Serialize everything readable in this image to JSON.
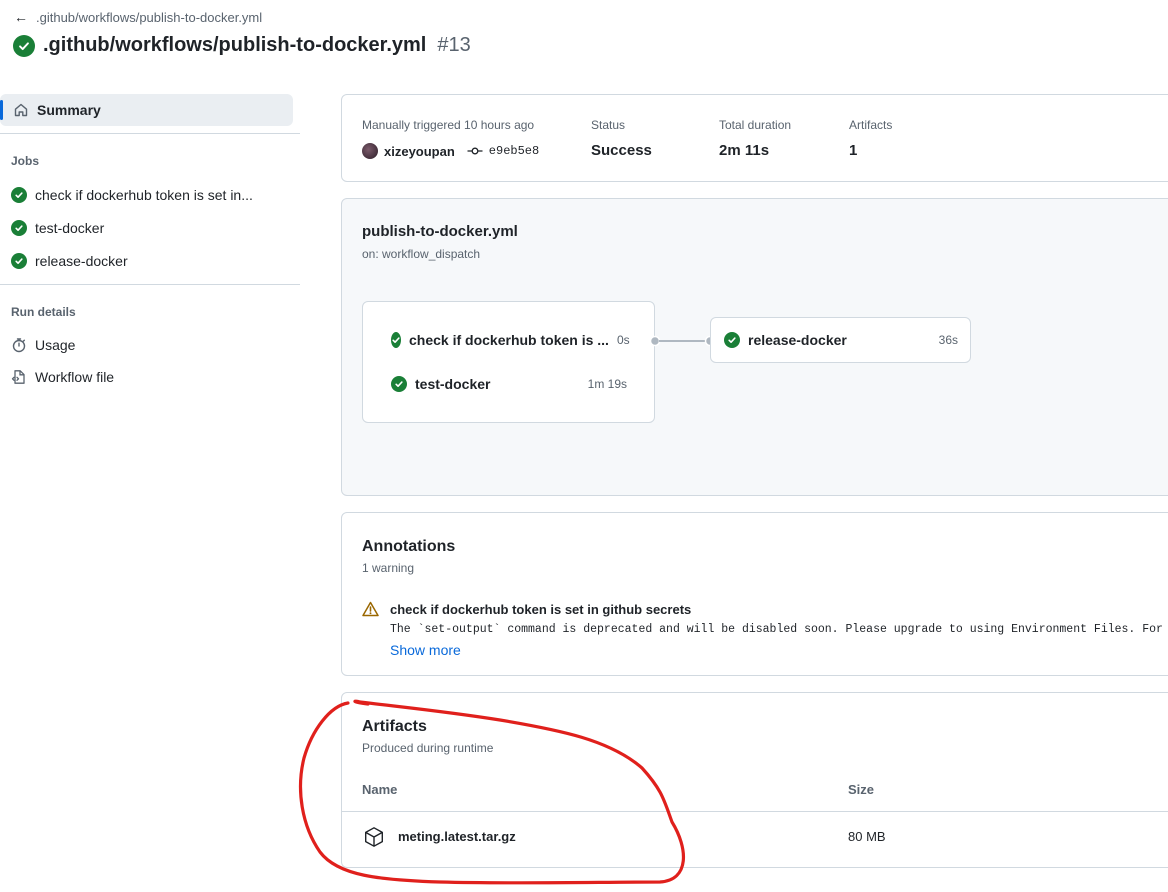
{
  "header": {
    "back_label": ".github/workflows/publish-to-docker.yml",
    "title": ".github/workflows/publish-to-docker.yml",
    "run_number": "#13"
  },
  "sidebar": {
    "summary_label": "Summary",
    "jobs_heading": "Jobs",
    "jobs": [
      {
        "label": "check if dockerhub token is set in..."
      },
      {
        "label": "test-docker"
      },
      {
        "label": "release-docker"
      }
    ],
    "run_details_heading": "Run details",
    "details": [
      {
        "label": "Usage",
        "icon": "stopwatch-icon"
      },
      {
        "label": "Workflow file",
        "icon": "file-code-icon"
      }
    ]
  },
  "run_meta": {
    "trigger_label": "Manually triggered 10 hours ago",
    "user": "xizeyoupan",
    "commit": "e9eb5e8",
    "status_label": "Status",
    "status_value": "Success",
    "duration_label": "Total duration",
    "duration_value": "2m 11s",
    "artifacts_label": "Artifacts",
    "artifacts_value": "1"
  },
  "workflow_graph": {
    "file": "publish-to-docker.yml",
    "trigger": "on: workflow_dispatch",
    "group_jobs": [
      {
        "label": "check if dockerhub token is ...",
        "duration": "0s"
      },
      {
        "label": "test-docker",
        "duration": "1m 19s"
      }
    ],
    "downstream_job": {
      "label": "release-docker",
      "duration": "36s"
    }
  },
  "annotations": {
    "title": "Annotations",
    "subtitle": "1 warning",
    "warning_title": "check if dockerhub token is set in github secrets",
    "warning_text": "The `set-output` command is deprecated and will be disabled soon. Please upgrade to using Environment Files. For more",
    "show_more": "Show more"
  },
  "artifacts": {
    "title": "Artifacts",
    "subtitle": "Produced during runtime",
    "col_name": "Name",
    "col_size": "Size",
    "rows": [
      {
        "name": "meting.latest.tar.gz",
        "size": "80 MB"
      }
    ]
  },
  "colors": {
    "success": "#1a7f37",
    "accent": "#0969da",
    "warning": "#9a6700",
    "highlight_circle": "#e0201c"
  }
}
